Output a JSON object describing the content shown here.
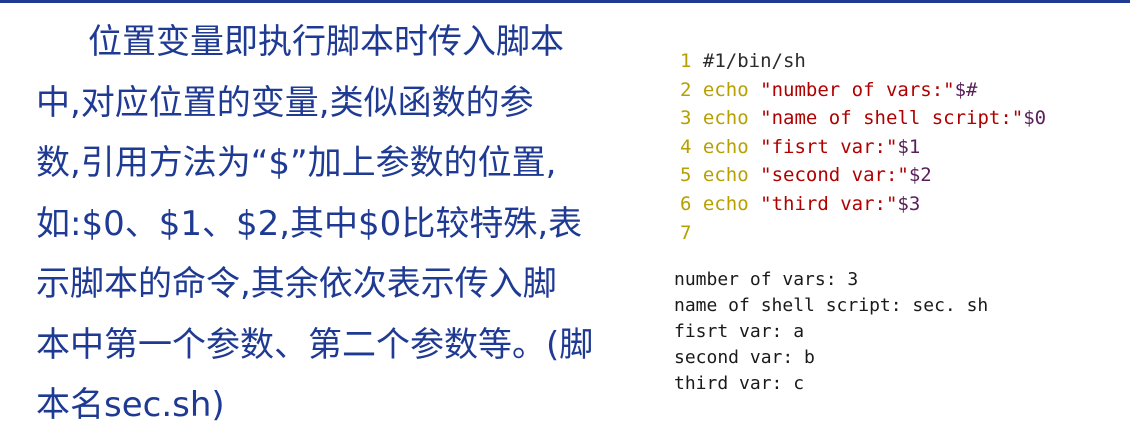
{
  "paragraph": {
    "lines": [
      "位置变量即执行脚本时传入脚本",
      "中,对应位置的变量,类似函数的参",
      "数,引用方法为“$”加上参数的位置,",
      "如:$0、$1、$2,其中$0比较特殊,表",
      "示脚本的命令,其余依次表示传入脚",
      "本中第一个参数、第二个参数等。(脚",
      "本名sec.sh)"
    ]
  },
  "code": {
    "lines": [
      {
        "num": "1",
        "parts": [
          {
            "t": "#1/bin/sh",
            "c": "plain"
          }
        ]
      },
      {
        "num": "2",
        "parts": [
          {
            "t": "echo",
            "c": "kw"
          },
          {
            "t": " ",
            "c": "plain"
          },
          {
            "t": "\"number of vars:\"",
            "c": "str"
          },
          {
            "t": "$#",
            "c": "var"
          }
        ]
      },
      {
        "num": "3",
        "parts": [
          {
            "t": "echo",
            "c": "kw"
          },
          {
            "t": " ",
            "c": "plain"
          },
          {
            "t": "\"name of shell script:\"",
            "c": "str"
          },
          {
            "t": "$0",
            "c": "var"
          }
        ]
      },
      {
        "num": "4",
        "parts": [
          {
            "t": "echo",
            "c": "kw"
          },
          {
            "t": " ",
            "c": "plain"
          },
          {
            "t": "\"fisrt var:\"",
            "c": "str"
          },
          {
            "t": "$1",
            "c": "var"
          }
        ]
      },
      {
        "num": "5",
        "parts": [
          {
            "t": "echo",
            "c": "kw"
          },
          {
            "t": " ",
            "c": "plain"
          },
          {
            "t": "\"second var:\"",
            "c": "str"
          },
          {
            "t": "$2",
            "c": "var"
          }
        ]
      },
      {
        "num": "6",
        "parts": [
          {
            "t": "echo",
            "c": "kw"
          },
          {
            "t": " ",
            "c": "plain"
          },
          {
            "t": "\"third var:\"",
            "c": "str"
          },
          {
            "t": "$3",
            "c": "var"
          }
        ]
      },
      {
        "num": "7",
        "parts": []
      }
    ]
  },
  "output": {
    "lines": [
      "number of vars: 3",
      "name of shell script: sec. sh",
      "fisrt var: a",
      "second var: b",
      "third var: c"
    ]
  }
}
